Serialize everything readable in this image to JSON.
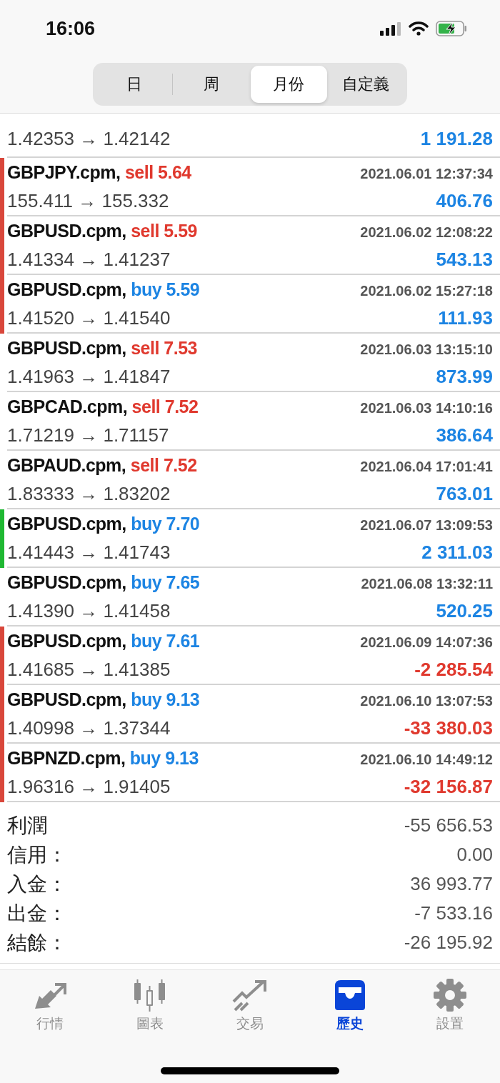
{
  "status_bar": {
    "time": "16:06"
  },
  "period_tabs": [
    {
      "label": "日",
      "selected": false
    },
    {
      "label": "周",
      "selected": false
    },
    {
      "label": "月份",
      "selected": true
    },
    {
      "label": "自定義",
      "selected": false
    }
  ],
  "trades": [
    {
      "partial": true,
      "prices": "1.42353 → 1.42142",
      "profit": "1 191.28",
      "loss": false
    },
    {
      "partial": false,
      "symbol": "GBPJPY.cpm,",
      "type": "sell",
      "volume": "5.64",
      "time": "2021.06.01 12:37:34",
      "prices": "155.411 → 155.332",
      "profit": "406.76",
      "loss": false,
      "color": "#d9473b"
    },
    {
      "partial": false,
      "symbol": "GBPUSD.cpm,",
      "type": "sell",
      "volume": "5.59",
      "time": "2021.06.02 12:08:22",
      "prices": "1.41334 → 1.41237",
      "profit": "543.13",
      "loss": false,
      "color": "#d9473b"
    },
    {
      "partial": false,
      "symbol": "GBPUSD.cpm,",
      "type": "buy",
      "volume": "5.59",
      "time": "2021.06.02 15:27:18",
      "prices": "1.41520 → 1.41540",
      "profit": "111.93",
      "loss": false,
      "color": "#d9473b"
    },
    {
      "partial": false,
      "symbol": "GBPUSD.cpm,",
      "type": "sell",
      "volume": "7.53",
      "time": "2021.06.03 13:15:10",
      "prices": "1.41963 → 1.41847",
      "profit": "873.99",
      "loss": false
    },
    {
      "partial": false,
      "symbol": "GBPCAD.cpm,",
      "type": "sell",
      "volume": "7.52",
      "time": "2021.06.03 14:10:16",
      "prices": "1.71219 → 1.71157",
      "profit": "386.64",
      "loss": false
    },
    {
      "partial": false,
      "symbol": "GBPAUD.cpm,",
      "type": "sell",
      "volume": "7.52",
      "time": "2021.06.04 17:01:41",
      "prices": "1.83333 → 1.83202",
      "profit": "763.01",
      "loss": false
    },
    {
      "partial": false,
      "symbol": "GBPUSD.cpm,",
      "type": "buy",
      "volume": "7.70",
      "time": "2021.06.07 13:09:53",
      "prices": "1.41443 → 1.41743",
      "profit": "2 311.03",
      "loss": false,
      "color": "#1fb832"
    },
    {
      "partial": false,
      "symbol": "GBPUSD.cpm,",
      "type": "buy",
      "volume": "7.65",
      "time": "2021.06.08 13:32:11",
      "prices": "1.41390 → 1.41458",
      "profit": "520.25",
      "loss": false
    },
    {
      "partial": false,
      "symbol": "GBPUSD.cpm,",
      "type": "buy",
      "volume": "7.61",
      "time": "2021.06.09 14:07:36",
      "prices": "1.41685 → 1.41385",
      "profit": "-2 285.54",
      "loss": true,
      "color": "#d9473b"
    },
    {
      "partial": false,
      "symbol": "GBPUSD.cpm,",
      "type": "buy",
      "volume": "9.13",
      "time": "2021.06.10 13:07:53",
      "prices": "1.40998 → 1.37344",
      "profit": "-33 380.03",
      "loss": true,
      "color": "#d9473b"
    },
    {
      "partial": false,
      "symbol": "GBPNZD.cpm,",
      "type": "buy",
      "volume": "9.13",
      "time": "2021.06.10 14:49:12",
      "prices": "1.96316 → 1.91405",
      "profit": "-32 156.87",
      "loss": true,
      "color": "#d9473b"
    }
  ],
  "summary": [
    {
      "label": "利潤",
      "value": "-55 656.53"
    },
    {
      "label": "信用：",
      "value": "0.00"
    },
    {
      "label": "入金：",
      "value": "36 993.77"
    },
    {
      "label": "出金：",
      "value": "-7 533.16"
    },
    {
      "label": "結餘：",
      "value": "-26 195.92"
    }
  ],
  "tab_bar": [
    {
      "kind": "quotes",
      "label": "行情",
      "selected": false
    },
    {
      "kind": "chart",
      "label": "圖表",
      "selected": false
    },
    {
      "kind": "trade",
      "label": "交易",
      "selected": false
    },
    {
      "kind": "history",
      "label": "歷史",
      "selected": true
    },
    {
      "kind": "settings",
      "label": "設置",
      "selected": false
    }
  ]
}
